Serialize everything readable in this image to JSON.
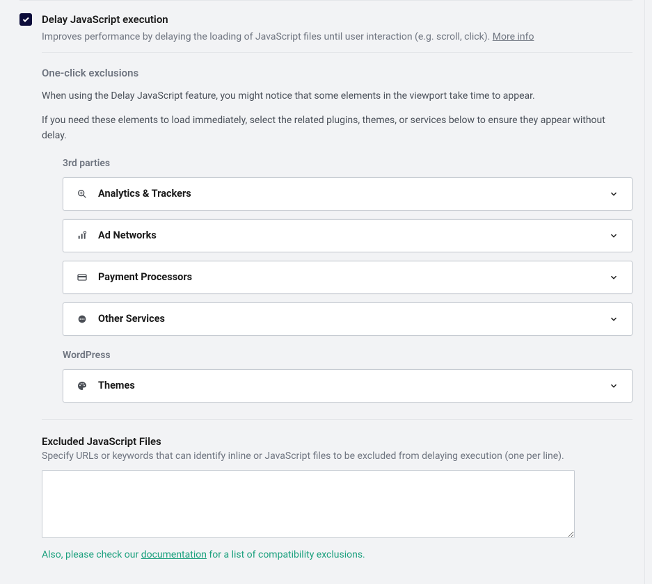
{
  "option": {
    "title": "Delay JavaScript execution",
    "description": "Improves performance by delaying the loading of JavaScript files until user interaction (e.g. scroll, click). ",
    "more_info": "More info",
    "checked": true
  },
  "exclusions": {
    "heading": "One-click exclusions",
    "line1": "When using the Delay JavaScript feature, you might notice that some elements in the viewport take time to appear.",
    "line2": "If you need these elements to load immediately, select the related plugins, themes, or services below to ensure they appear without delay.",
    "groups": [
      {
        "label": "3rd parties",
        "items": [
          {
            "label": "Analytics & Trackers",
            "icon": "analytics-icon"
          },
          {
            "label": "Ad Networks",
            "icon": "ads-icon"
          },
          {
            "label": "Payment Processors",
            "icon": "card-icon"
          },
          {
            "label": "Other Services",
            "icon": "dots-icon"
          }
        ]
      },
      {
        "label": "WordPress",
        "items": [
          {
            "label": "Themes",
            "icon": "palette-icon"
          }
        ]
      }
    ]
  },
  "excluded_files": {
    "title": "Excluded JavaScript Files",
    "description": "Specify URLs or keywords that can identify inline or JavaScript files to be excluded from delaying execution (one per line).",
    "value": ""
  },
  "doc_note": {
    "prefix": "Also, please check our ",
    "link": "documentation",
    "suffix": " for a list of compatibility exclusions."
  }
}
